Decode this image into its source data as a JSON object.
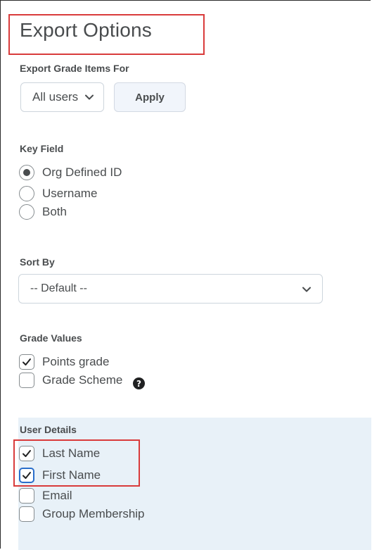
{
  "page": {
    "title": "Export Options"
  },
  "export_for": {
    "label": "Export Grade Items For",
    "selected": "All users",
    "apply_label": "Apply"
  },
  "key_field": {
    "label": "Key Field",
    "options": [
      {
        "label": "Org Defined ID",
        "selected": true
      },
      {
        "label": "Username",
        "selected": false
      },
      {
        "label": "Both",
        "selected": false
      }
    ]
  },
  "sort_by": {
    "label": "Sort By",
    "selected": "-- Default --"
  },
  "grade_values": {
    "label": "Grade Values",
    "options": [
      {
        "label": "Points grade",
        "checked": true
      },
      {
        "label": "Grade Scheme",
        "checked": false
      }
    ],
    "help_icon": "question-circle-icon",
    "help_glyph": "?"
  },
  "user_details": {
    "label": "User Details",
    "options": [
      {
        "label": "Last Name",
        "checked": true
      },
      {
        "label": "First Name",
        "checked": true
      },
      {
        "label": "Email",
        "checked": false
      },
      {
        "label": "Group Membership",
        "checked": false
      }
    ]
  },
  "colors": {
    "text": "#494c4e",
    "panel": "#e8f1f8",
    "highlight": "#d93b3b",
    "focus": "#2a6ecb"
  }
}
